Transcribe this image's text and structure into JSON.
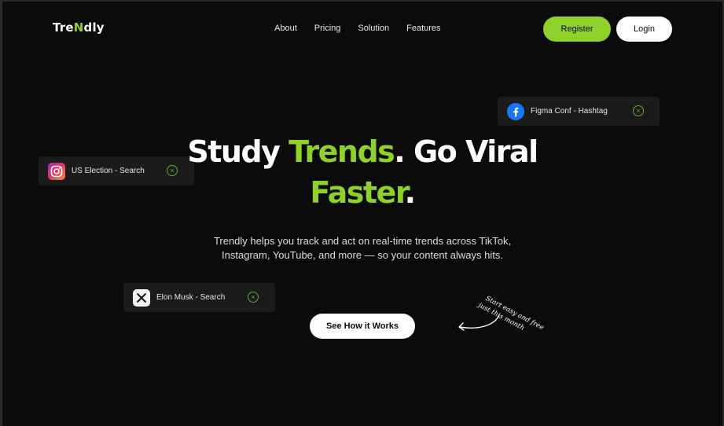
{
  "brand": {
    "logo_pre": "Tre",
    "logo_accent": "N",
    "logo_post": "dly",
    "accent_color": "#8fd12a"
  },
  "nav": {
    "items": [
      "About",
      "Pricing",
      "Solution",
      "Features"
    ],
    "register_label": "Register",
    "login_label": "Login"
  },
  "hero": {
    "line1_a": "Study ",
    "line1_green": "Trends",
    "line1_b": ". Go Viral",
    "line2_green": "Faster",
    "line2_b": ".",
    "subtitle": "Trendly helps you track and act on real-time trends across TikTok, Instagram, YouTube, and more — so your content always hits.",
    "cta_label": "See How it Works",
    "note_line1": "Start easy and free",
    "note_line2": "just this month"
  },
  "chips": [
    {
      "label": "US Election - Search",
      "icon": "instagram-icon"
    },
    {
      "label": "Figma Conf - Hashtag",
      "icon": "facebook-icon"
    },
    {
      "label": "Elon Musk - Search",
      "icon": "x-icon"
    }
  ]
}
